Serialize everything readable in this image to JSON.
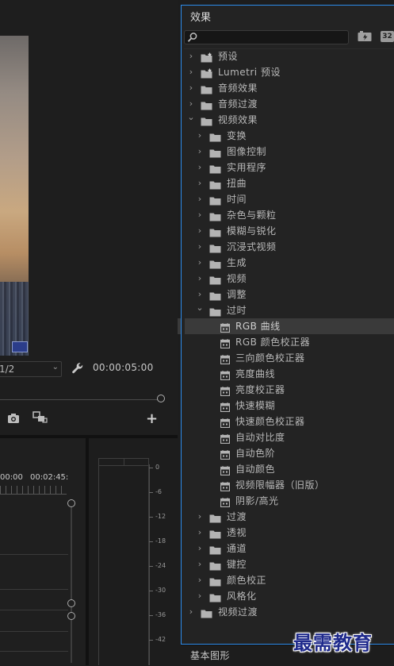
{
  "monitor": {
    "resolution": "1/2",
    "timecode": "00:00:05:00"
  },
  "timeline": {
    "times": [
      "00:00",
      "00:02:45:"
    ]
  },
  "meters": {
    "db_labels": [
      "0",
      "-6",
      "-12",
      "-18",
      "-24",
      "-30",
      "-36",
      "-42"
    ]
  },
  "effects": {
    "title": "效果",
    "search_value": "",
    "bit32_label": "32",
    "tree": [
      {
        "label": "预设",
        "depth": 0,
        "expanded": false,
        "icon": "preset-folder-icon"
      },
      {
        "label": "Lumetri 预设",
        "depth": 0,
        "expanded": false,
        "icon": "preset-folder-icon"
      },
      {
        "label": "音频效果",
        "depth": 0,
        "expanded": false,
        "icon": "folder-icon"
      },
      {
        "label": "音频过渡",
        "depth": 0,
        "expanded": false,
        "icon": "folder-icon"
      },
      {
        "label": "视频效果",
        "depth": 0,
        "expanded": true,
        "icon": "folder-icon"
      },
      {
        "label": "变换",
        "depth": 1,
        "expanded": false,
        "icon": "folder-icon"
      },
      {
        "label": "图像控制",
        "depth": 1,
        "expanded": false,
        "icon": "folder-icon"
      },
      {
        "label": "实用程序",
        "depth": 1,
        "expanded": false,
        "icon": "folder-icon"
      },
      {
        "label": "扭曲",
        "depth": 1,
        "expanded": false,
        "icon": "folder-icon"
      },
      {
        "label": "时间",
        "depth": 1,
        "expanded": false,
        "icon": "folder-icon"
      },
      {
        "label": "杂色与颗粒",
        "depth": 1,
        "expanded": false,
        "icon": "folder-icon"
      },
      {
        "label": "模糊与锐化",
        "depth": 1,
        "expanded": false,
        "icon": "folder-icon"
      },
      {
        "label": "沉浸式视频",
        "depth": 1,
        "expanded": false,
        "icon": "folder-icon"
      },
      {
        "label": "生成",
        "depth": 1,
        "expanded": false,
        "icon": "folder-icon"
      },
      {
        "label": "视频",
        "depth": 1,
        "expanded": false,
        "icon": "folder-icon"
      },
      {
        "label": "调整",
        "depth": 1,
        "expanded": false,
        "icon": "folder-icon"
      },
      {
        "label": "过时",
        "depth": 1,
        "expanded": true,
        "icon": "folder-icon"
      },
      {
        "label": "RGB 曲线",
        "depth": 2,
        "icon": "effect-icon",
        "selected": true
      },
      {
        "label": "RGB 颜色校正器",
        "depth": 2,
        "icon": "effect-icon"
      },
      {
        "label": "三向颜色校正器",
        "depth": 2,
        "icon": "effect-icon"
      },
      {
        "label": "亮度曲线",
        "depth": 2,
        "icon": "effect-icon"
      },
      {
        "label": "亮度校正器",
        "depth": 2,
        "icon": "effect-icon"
      },
      {
        "label": "快速模糊",
        "depth": 2,
        "icon": "effect-icon"
      },
      {
        "label": "快速颜色校正器",
        "depth": 2,
        "icon": "effect-icon"
      },
      {
        "label": "自动对比度",
        "depth": 2,
        "icon": "effect-icon"
      },
      {
        "label": "自动色阶",
        "depth": 2,
        "icon": "effect-icon"
      },
      {
        "label": "自动颜色",
        "depth": 2,
        "icon": "effect-icon"
      },
      {
        "label": "视频限幅器（旧版）",
        "depth": 2,
        "icon": "effect-icon"
      },
      {
        "label": "阴影/高光",
        "depth": 2,
        "icon": "effect-icon"
      },
      {
        "label": "过渡",
        "depth": 1,
        "expanded": false,
        "icon": "folder-icon"
      },
      {
        "label": "透视",
        "depth": 1,
        "expanded": false,
        "icon": "folder-icon"
      },
      {
        "label": "通道",
        "depth": 1,
        "expanded": false,
        "icon": "folder-icon"
      },
      {
        "label": "键控",
        "depth": 1,
        "expanded": false,
        "icon": "folder-icon"
      },
      {
        "label": "颜色校正",
        "depth": 1,
        "expanded": false,
        "icon": "folder-icon"
      },
      {
        "label": "风格化",
        "depth": 1,
        "expanded": false,
        "icon": "folder-icon"
      },
      {
        "label": "视频过渡",
        "depth": 0,
        "expanded": false,
        "icon": "folder-icon"
      }
    ]
  },
  "bottom_panel": {
    "title": "基本图形"
  },
  "watermark": "最需教育",
  "colors": {
    "accent_border": "#2d8ceb",
    "selected_row": "#3a3a3a",
    "watermark": "#1f2a8c"
  }
}
